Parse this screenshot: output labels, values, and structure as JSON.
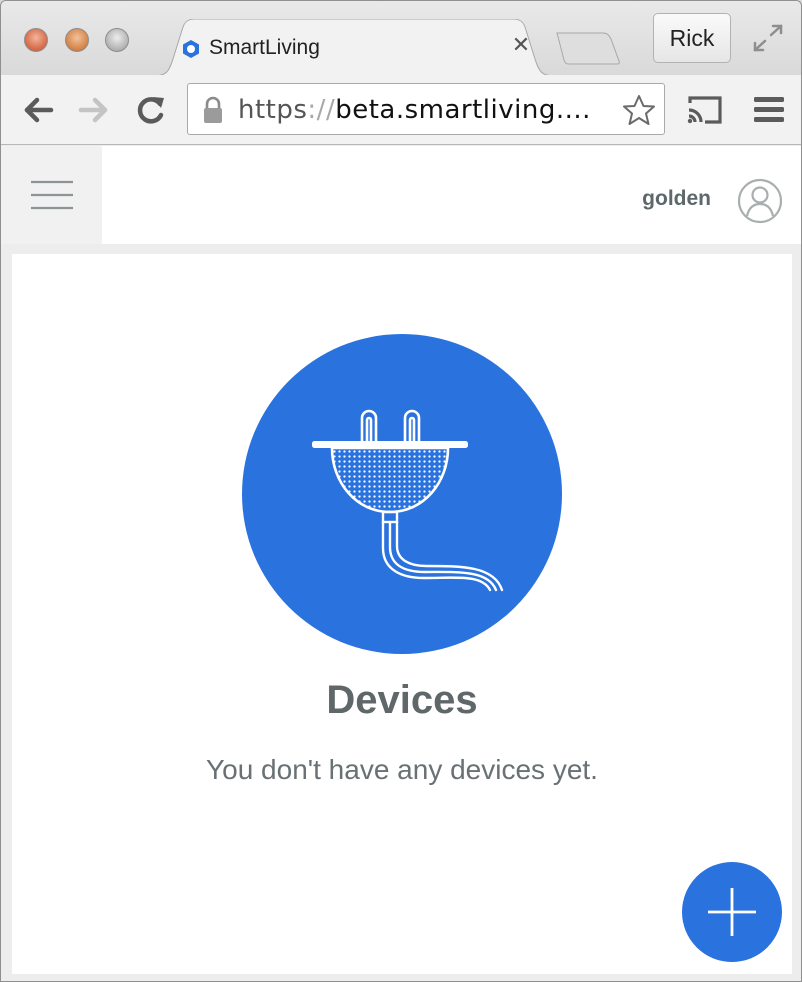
{
  "browser": {
    "tab": {
      "title": "SmartLiving"
    },
    "profile_button": "Rick",
    "url": {
      "scheme": "https",
      "slashes": "://",
      "host": "beta.smartliving...."
    }
  },
  "app": {
    "username": "golden",
    "empty_state": {
      "title": "Devices",
      "message": "You don't have any devices yet."
    }
  },
  "colors": {
    "accent": "#2a72de",
    "text_dark": "#5f6769",
    "text_muted": "#697174"
  },
  "icons": {
    "tab_favicon": "smartliving-logo-icon",
    "back": "arrow-left-icon",
    "forward": "arrow-right-icon",
    "reload": "reload-icon",
    "lock": "lock-icon",
    "bookmark": "star-icon",
    "cast": "cast-icon",
    "chrome_menu": "hamburger-icon",
    "app_menu": "hamburger-icon",
    "avatar": "user-avatar-icon",
    "devices": "plug-icon",
    "add": "plus-icon"
  }
}
